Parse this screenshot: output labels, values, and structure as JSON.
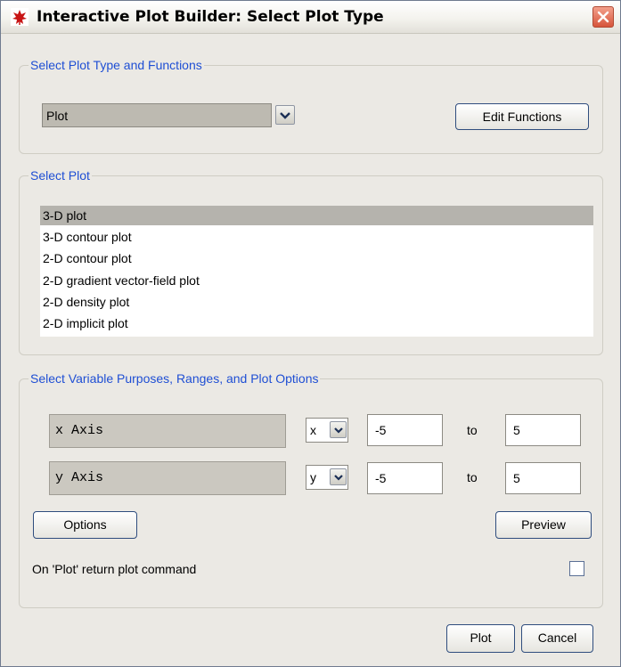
{
  "window": {
    "title": "Interactive Plot Builder: Select Plot Type"
  },
  "plot_type_group": {
    "legend": "Select Plot Type and Functions",
    "selected_type": "Plot",
    "edit_functions_label": "Edit Functions"
  },
  "select_plot_group": {
    "legend": "Select Plot",
    "items": [
      "3-D plot",
      "3-D contour plot",
      "2-D contour plot",
      "2-D gradient vector-field plot",
      "2-D density plot",
      "2-D implicit plot"
    ],
    "selected_item": "3-D plot"
  },
  "variables_group": {
    "legend": "Select Variable Purposes, Ranges, and Plot Options",
    "rows": [
      {
        "label": "x Axis",
        "variable": "x",
        "from": "-5",
        "to_label": "to",
        "to": "5"
      },
      {
        "label": "y Axis",
        "variable": "y",
        "from": "-5",
        "to_label": "to",
        "to": "5"
      }
    ],
    "options_label": "Options",
    "preview_label": "Preview",
    "return_command_label": "On 'Plot' return plot command",
    "return_command_checked": false
  },
  "footer": {
    "plot_label": "Plot",
    "cancel_label": "Cancel"
  },
  "colors": {
    "legend_text": "#1f4fd4",
    "dialog_background": "#ebe9e4",
    "close_button": "#d6543b",
    "selected_list_item": "#b5b3ad"
  },
  "icons": {
    "app": "maple-leaf-icon",
    "close": "close-icon",
    "dropdown": "chevron-down-icon"
  }
}
